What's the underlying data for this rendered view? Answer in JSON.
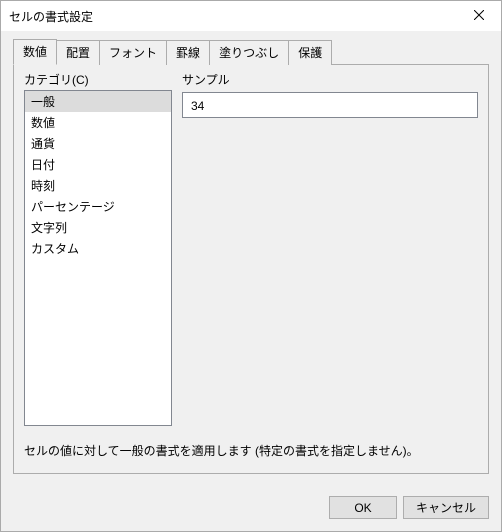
{
  "window": {
    "title": "セルの書式設定"
  },
  "tabs": [
    {
      "label": "数値",
      "active": true
    },
    {
      "label": "配置",
      "active": false
    },
    {
      "label": "フォント",
      "active": false
    },
    {
      "label": "罫線",
      "active": false
    },
    {
      "label": "塗りつぶし",
      "active": false
    },
    {
      "label": "保護",
      "active": false
    }
  ],
  "category": {
    "label": "カテゴリ(C)",
    "items": [
      {
        "label": "一般",
        "selected": true
      },
      {
        "label": "数値",
        "selected": false
      },
      {
        "label": "通貨",
        "selected": false
      },
      {
        "label": "日付",
        "selected": false
      },
      {
        "label": "時刻",
        "selected": false
      },
      {
        "label": "パーセンテージ",
        "selected": false
      },
      {
        "label": "文字列",
        "selected": false
      },
      {
        "label": "カスタム",
        "selected": false
      }
    ]
  },
  "sample": {
    "label": "サンプル",
    "value": "34"
  },
  "description": "セルの値に対して一般の書式を適用します (特定の書式を指定しません)。",
  "buttons": {
    "ok": "OK",
    "cancel": "キャンセル"
  }
}
